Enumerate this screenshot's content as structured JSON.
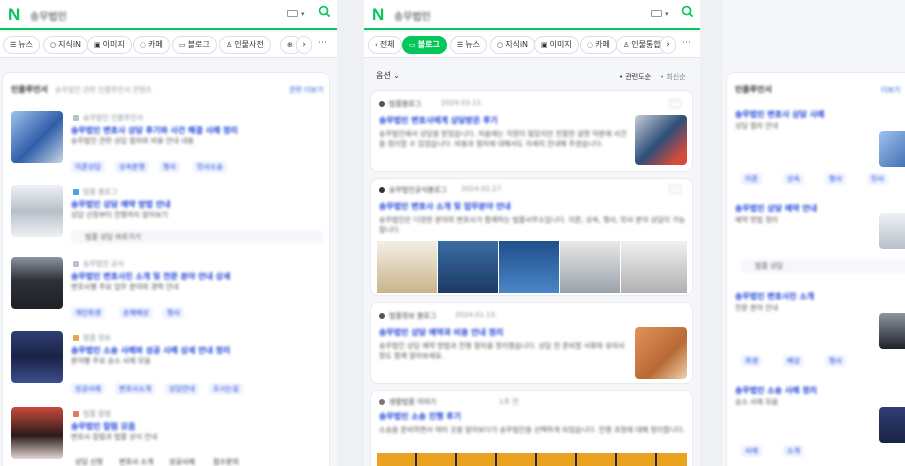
{
  "app": {
    "logo": "N",
    "query": "송무법인"
  },
  "panel1": {
    "tabs": [
      {
        "icon": "☰",
        "label": "뉴스"
      },
      {
        "icon": "○",
        "label": "지식iN"
      },
      {
        "icon": "▣",
        "label": "이미지"
      },
      {
        "icon": "◌",
        "label": "카페"
      },
      {
        "icon": "▭",
        "label": "블로그"
      },
      {
        "icon": "♙",
        "label": "인물사전"
      },
      {
        "icon": "⊕",
        "label": ""
      }
    ],
    "section": {
      "title": "인플루언서",
      "subtitle": "송무법인 관련 인플루언서 콘텐츠",
      "link": "관련 더보기"
    },
    "items": [
      {
        "source": "송무법인 인플루언서",
        "title": "송무법인 변호사 상담 후기와 사건 해결 사례 정리",
        "desc": "송무법인 관련 상담 절차와 비용 안내 내용",
        "chips": [
          "이혼상담",
          "상속분쟁",
          "형사",
          "민사소송"
        ]
      },
      {
        "source": "법률 블로그",
        "title": "송무법인 상담 예약 방법 안내",
        "desc": "상담 신청부터 진행까지 알아보기",
        "chips": [
          "법률 상담 바로가기"
        ]
      },
      {
        "source": "송무법인 공식",
        "title": "송무법인 변호사진 소개 및 전문 분야 안내 상세",
        "desc": "변호사별 주요 업무 분야와 경력 안내",
        "chips": [
          "개인회생",
          "손해배상",
          "형사"
        ]
      },
      {
        "source": "법률 정보",
        "title": "송무법인 소송 사례와 성공 사례 상세 안내 정리",
        "desc": "분야별 주요 승소 사례 모음",
        "chips": [
          "성공사례",
          "변호사소개",
          "상담안내",
          "오시는길"
        ]
      },
      {
        "source": "법률 칼럼",
        "title": "송무법인 칼럼 모음",
        "desc": "변호사 칼럼과 법률 상식 안내",
        "chips": [
          "상담 신청",
          "변호사 소개",
          "성공사례",
          "접수문의"
        ]
      }
    ]
  },
  "panel2": {
    "tabs": [
      {
        "icon": "‹",
        "label": "전체"
      },
      {
        "icon": "▭",
        "label": "블로그"
      },
      {
        "icon": "☰",
        "label": "뉴스"
      },
      {
        "icon": "○",
        "label": "지식iN"
      },
      {
        "icon": "▣",
        "label": "이미지"
      },
      {
        "icon": "◌",
        "label": "카페"
      },
      {
        "icon": "♙",
        "label": "인물통합"
      }
    ],
    "filter": "옵션",
    "sort_a": "관련도순",
    "sort_b": "최신순",
    "posts": [
      {
        "author": "법률블로그",
        "date": "2024.03.11.",
        "title": "송무법인 변호사에게 상담받은 후기",
        "desc": "송무법인에서 상담을 받았습니다. 처음에는 걱정이 많았지만 친절한 설명 덕분에 사건을 정리할 수 있었습니다. 비용과 절차에 대해서도 자세히 안내해 주셨습니다."
      },
      {
        "author": "송무법인공식블로그",
        "date": "2024.02.27.",
        "title": "송무법인 변호사 소개 및 업무분야 안내",
        "desc": "송무법인은 다양한 분야의 변호사가 함께하는 법률사무소입니다. 이혼, 상속, 형사, 민사 분야 상담이 가능합니다."
      },
      {
        "author": "법률정보 블로그",
        "date": "2024.01.15.",
        "title": "송무법인 상담 예약과 비용 안내 정리",
        "desc": "송무법인 상담 예약 방법과 진행 절차를 정리했습니다. 상담 전 준비할 서류와 유의사항도 함께 알아보세요."
      },
      {
        "author": "생활법률 이야기",
        "date": "1주 전",
        "title": "송무법인 소송 진행 후기",
        "desc": "소송을 준비하면서 여러 곳을 알아보다가 송무법인을 선택하게 되었습니다. 진행 과정에 대해 정리합니다."
      }
    ]
  },
  "panel3": {
    "section": {
      "title": "인플루언서",
      "link": "더보기"
    },
    "items": [
      {
        "title": "송무법인 변호사 상담 사례",
        "desc": "상담 절차 안내",
        "chips": [
          "이혼",
          "상속",
          "형사",
          "민사"
        ]
      },
      {
        "title": "송무법인 상담 예약 안내",
        "desc": "예약 방법 정리",
        "chips": [
          "법률 상담"
        ]
      },
      {
        "title": "송무법인 변호사진 소개",
        "desc": "전문 분야 안내",
        "chips": [
          "회생",
          "배상",
          "형사"
        ]
      },
      {
        "title": "송무법인 소송 사례 정리",
        "desc": "승소 사례 모음",
        "chips": [
          "사례",
          "소개"
        ]
      }
    ]
  }
}
